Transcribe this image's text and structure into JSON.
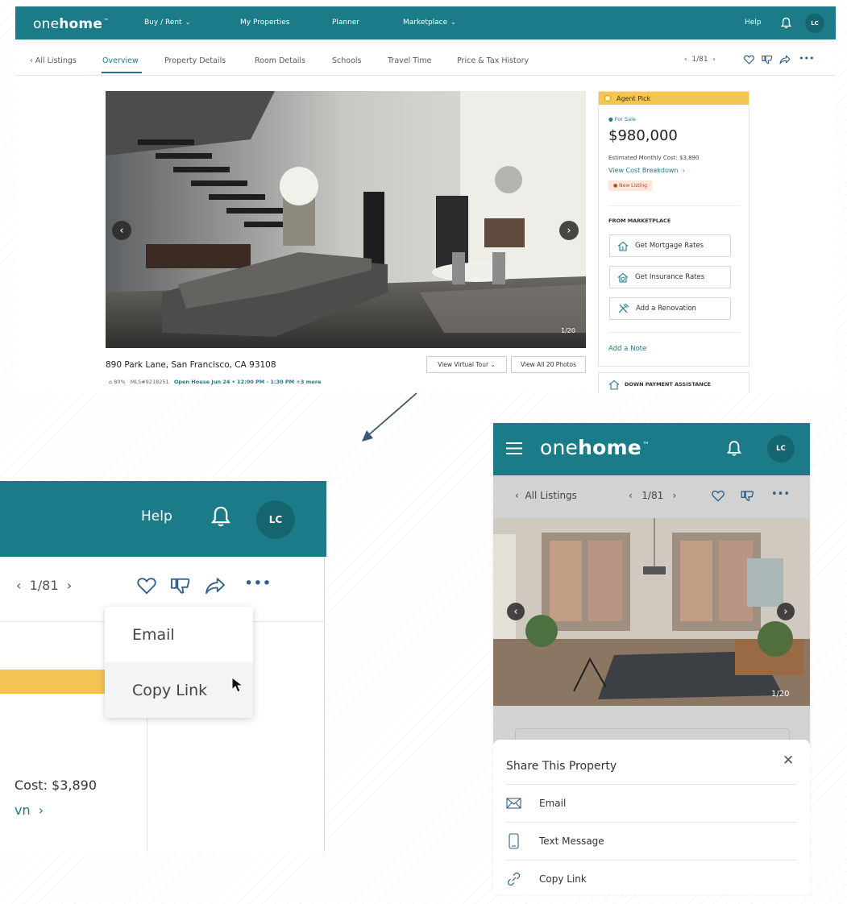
{
  "brand": {
    "logo_light": "one",
    "logo_bold": "home",
    "logo_tm": "™",
    "teal": "#1c7b88",
    "yellow": "#f5c553"
  },
  "desktop": {
    "nav": {
      "items": [
        {
          "label": "Buy / Rent",
          "dropdown": true
        },
        {
          "label": "My Properties",
          "dropdown": false
        },
        {
          "label": "Planner",
          "dropdown": false
        },
        {
          "label": "Marketplace",
          "dropdown": true
        }
      ],
      "help": "Help",
      "avatar": "LC"
    },
    "tabs": {
      "back": "All Listings",
      "items": [
        "Overview",
        "Property Details",
        "Room Details",
        "Schools",
        "Travel Time",
        "Price & Tax History"
      ],
      "active": "Overview",
      "pager": "1/81"
    },
    "photo": {
      "counter": "1/20"
    },
    "listing": {
      "address": "890 Park Lane, San Francisco, CA 93108",
      "match": "80%",
      "mls": "MLS#9218251",
      "open_house": "Open House Jun 24 • 12:00 PM - 1:30 PM +3 more",
      "virtual_tour": "View Virtual Tour",
      "view_all": "View All 20 Photos"
    },
    "card": {
      "badge": "Agent Pick",
      "status": "For Sale",
      "price": "$980,000",
      "monthly": "Estimated Monthly Cost: $3,890",
      "breakdown": "View Cost Breakdown",
      "new_listing": "New Listing",
      "marketplace_heading": "FROM MARKETPLACE",
      "buttons": [
        "Get Mortgage Rates",
        "Get Insurance Rates",
        "Add a Renovation"
      ],
      "add_note": "Add a Note",
      "dpa": "DOWN PAYMENT ASSISTANCE"
    }
  },
  "zoom": {
    "help": "Help",
    "avatar": "LC",
    "pager": "1/81",
    "share_options": [
      "Email",
      "Copy Link"
    ],
    "cost_fragment": "Cost: $3,890",
    "breakdown_fragment": "vn"
  },
  "mobile": {
    "avatar": "LC",
    "back": "All Listings",
    "pager": "1/81",
    "photo_counter": "1/20",
    "sheet": {
      "title": "Share This Property",
      "options": [
        {
          "label": "Email",
          "icon": "envelope-icon"
        },
        {
          "label": "Text Message",
          "icon": "phone-icon"
        },
        {
          "label": "Copy Link",
          "icon": "link-icon"
        }
      ]
    }
  }
}
